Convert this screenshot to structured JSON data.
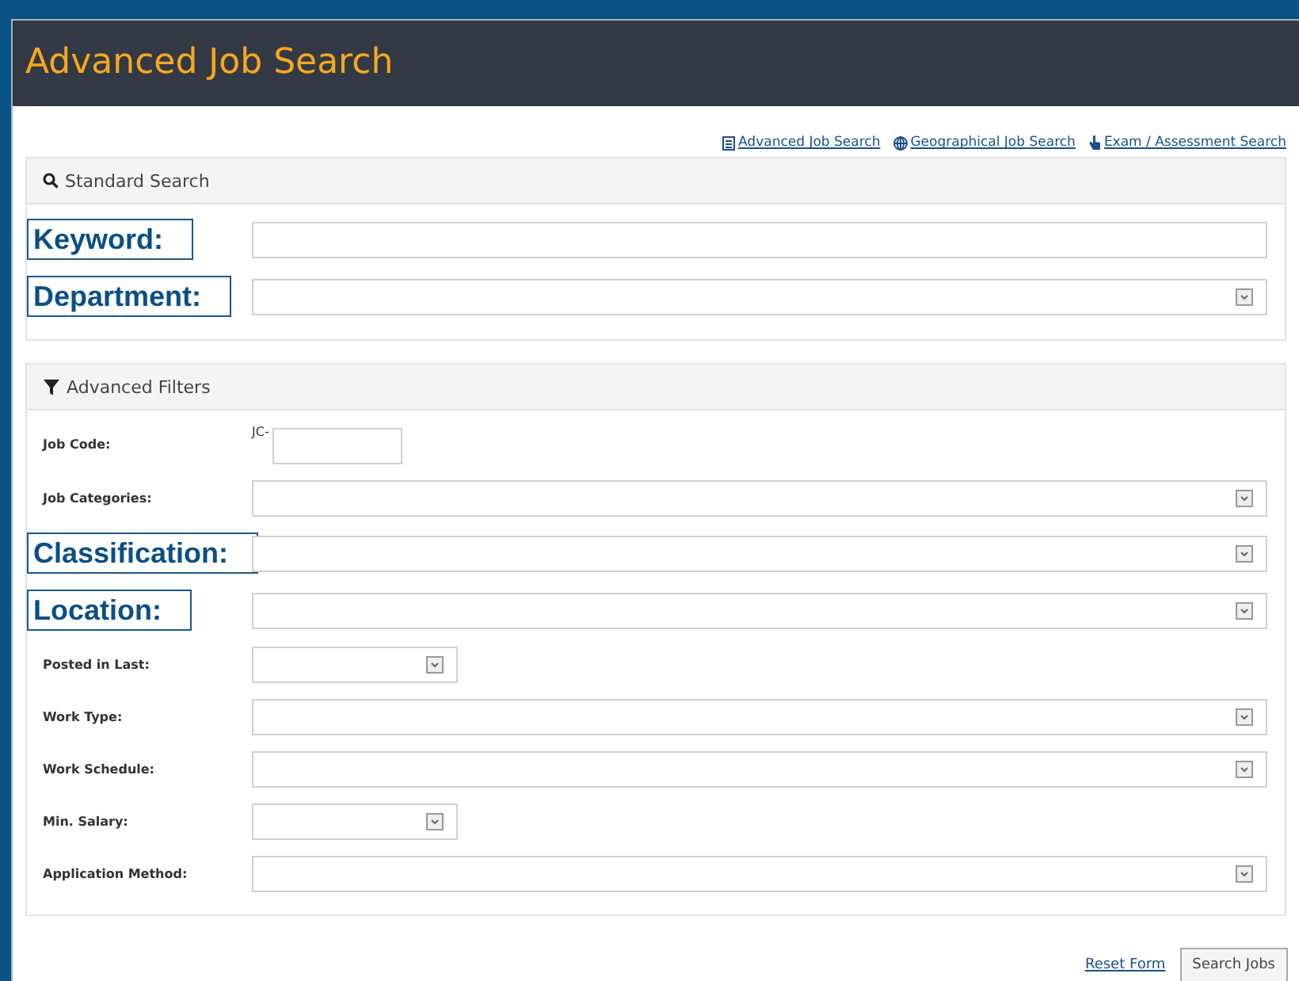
{
  "header": {
    "title": "Advanced Job Search"
  },
  "top_links": [
    {
      "label": "Advanced Job Search",
      "kind": "document"
    },
    {
      "label": "Geographical Job Search",
      "kind": "globe"
    },
    {
      "label": "Exam / Assessment Search",
      "kind": "pointer"
    }
  ],
  "panels": [
    {
      "title": "Standard Search",
      "kind": "search",
      "fields": [
        {
          "label": "Keyword:",
          "kind": "text",
          "highlighted": true
        },
        {
          "label": "Department:",
          "kind": "select",
          "highlighted": true
        }
      ]
    },
    {
      "title": "Advanced Filters",
      "kind": "filter",
      "fields": [
        {
          "label": "Job Code:",
          "kind": "code",
          "prefix": "JC-",
          "highlighted": false
        },
        {
          "label": "Job Categories:",
          "kind": "select",
          "highlighted": false
        },
        {
          "label": "Classification:",
          "kind": "select",
          "highlighted": true
        },
        {
          "label": "Location:",
          "kind": "select",
          "highlighted": true
        },
        {
          "label": "Posted in Last:",
          "kind": "small-select",
          "highlighted": false
        },
        {
          "label": "Work Type:",
          "kind": "select",
          "highlighted": false
        },
        {
          "label": "Work Schedule:",
          "kind": "select",
          "highlighted": false
        },
        {
          "label": "Min. Salary:",
          "kind": "small-select",
          "highlighted": false
        },
        {
          "label": "Application Method:",
          "kind": "select",
          "highlighted": false
        }
      ]
    }
  ],
  "actions": {
    "reset": "Reset Form",
    "submit": "Search Jobs"
  }
}
